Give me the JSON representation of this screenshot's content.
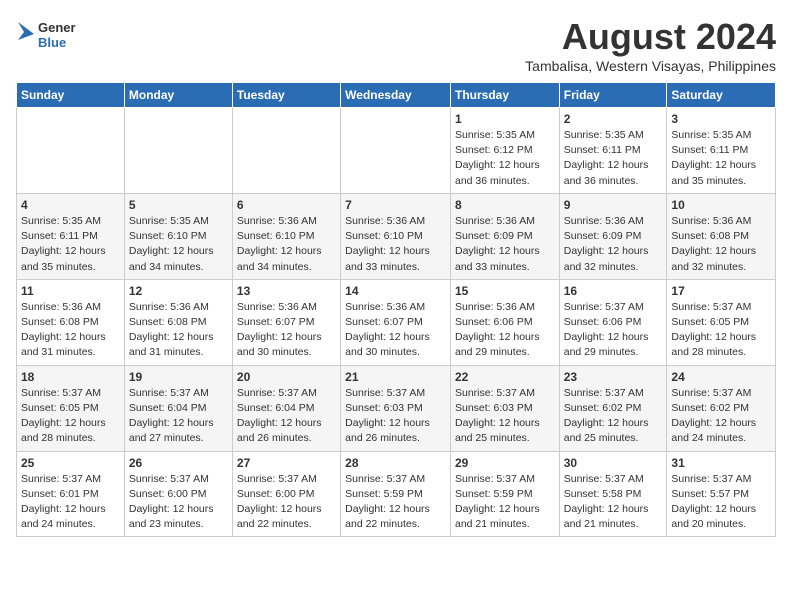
{
  "header": {
    "logo_general": "General",
    "logo_blue": "Blue",
    "title": "August 2024",
    "subtitle": "Tambalisa, Western Visayas, Philippines"
  },
  "calendar": {
    "days_of_week": [
      "Sunday",
      "Monday",
      "Tuesday",
      "Wednesday",
      "Thursday",
      "Friday",
      "Saturday"
    ],
    "weeks": [
      [
        {
          "num": "",
          "info": ""
        },
        {
          "num": "",
          "info": ""
        },
        {
          "num": "",
          "info": ""
        },
        {
          "num": "",
          "info": ""
        },
        {
          "num": "1",
          "info": "Sunrise: 5:35 AM\nSunset: 6:12 PM\nDaylight: 12 hours\nand 36 minutes."
        },
        {
          "num": "2",
          "info": "Sunrise: 5:35 AM\nSunset: 6:11 PM\nDaylight: 12 hours\nand 36 minutes."
        },
        {
          "num": "3",
          "info": "Sunrise: 5:35 AM\nSunset: 6:11 PM\nDaylight: 12 hours\nand 35 minutes."
        }
      ],
      [
        {
          "num": "4",
          "info": "Sunrise: 5:35 AM\nSunset: 6:11 PM\nDaylight: 12 hours\nand 35 minutes."
        },
        {
          "num": "5",
          "info": "Sunrise: 5:35 AM\nSunset: 6:10 PM\nDaylight: 12 hours\nand 34 minutes."
        },
        {
          "num": "6",
          "info": "Sunrise: 5:36 AM\nSunset: 6:10 PM\nDaylight: 12 hours\nand 34 minutes."
        },
        {
          "num": "7",
          "info": "Sunrise: 5:36 AM\nSunset: 6:10 PM\nDaylight: 12 hours\nand 33 minutes."
        },
        {
          "num": "8",
          "info": "Sunrise: 5:36 AM\nSunset: 6:09 PM\nDaylight: 12 hours\nand 33 minutes."
        },
        {
          "num": "9",
          "info": "Sunrise: 5:36 AM\nSunset: 6:09 PM\nDaylight: 12 hours\nand 32 minutes."
        },
        {
          "num": "10",
          "info": "Sunrise: 5:36 AM\nSunset: 6:08 PM\nDaylight: 12 hours\nand 32 minutes."
        }
      ],
      [
        {
          "num": "11",
          "info": "Sunrise: 5:36 AM\nSunset: 6:08 PM\nDaylight: 12 hours\nand 31 minutes."
        },
        {
          "num": "12",
          "info": "Sunrise: 5:36 AM\nSunset: 6:08 PM\nDaylight: 12 hours\nand 31 minutes."
        },
        {
          "num": "13",
          "info": "Sunrise: 5:36 AM\nSunset: 6:07 PM\nDaylight: 12 hours\nand 30 minutes."
        },
        {
          "num": "14",
          "info": "Sunrise: 5:36 AM\nSunset: 6:07 PM\nDaylight: 12 hours\nand 30 minutes."
        },
        {
          "num": "15",
          "info": "Sunrise: 5:36 AM\nSunset: 6:06 PM\nDaylight: 12 hours\nand 29 minutes."
        },
        {
          "num": "16",
          "info": "Sunrise: 5:37 AM\nSunset: 6:06 PM\nDaylight: 12 hours\nand 29 minutes."
        },
        {
          "num": "17",
          "info": "Sunrise: 5:37 AM\nSunset: 6:05 PM\nDaylight: 12 hours\nand 28 minutes."
        }
      ],
      [
        {
          "num": "18",
          "info": "Sunrise: 5:37 AM\nSunset: 6:05 PM\nDaylight: 12 hours\nand 28 minutes."
        },
        {
          "num": "19",
          "info": "Sunrise: 5:37 AM\nSunset: 6:04 PM\nDaylight: 12 hours\nand 27 minutes."
        },
        {
          "num": "20",
          "info": "Sunrise: 5:37 AM\nSunset: 6:04 PM\nDaylight: 12 hours\nand 26 minutes."
        },
        {
          "num": "21",
          "info": "Sunrise: 5:37 AM\nSunset: 6:03 PM\nDaylight: 12 hours\nand 26 minutes."
        },
        {
          "num": "22",
          "info": "Sunrise: 5:37 AM\nSunset: 6:03 PM\nDaylight: 12 hours\nand 25 minutes."
        },
        {
          "num": "23",
          "info": "Sunrise: 5:37 AM\nSunset: 6:02 PM\nDaylight: 12 hours\nand 25 minutes."
        },
        {
          "num": "24",
          "info": "Sunrise: 5:37 AM\nSunset: 6:02 PM\nDaylight: 12 hours\nand 24 minutes."
        }
      ],
      [
        {
          "num": "25",
          "info": "Sunrise: 5:37 AM\nSunset: 6:01 PM\nDaylight: 12 hours\nand 24 minutes."
        },
        {
          "num": "26",
          "info": "Sunrise: 5:37 AM\nSunset: 6:00 PM\nDaylight: 12 hours\nand 23 minutes."
        },
        {
          "num": "27",
          "info": "Sunrise: 5:37 AM\nSunset: 6:00 PM\nDaylight: 12 hours\nand 22 minutes."
        },
        {
          "num": "28",
          "info": "Sunrise: 5:37 AM\nSunset: 5:59 PM\nDaylight: 12 hours\nand 22 minutes."
        },
        {
          "num": "29",
          "info": "Sunrise: 5:37 AM\nSunset: 5:59 PM\nDaylight: 12 hours\nand 21 minutes."
        },
        {
          "num": "30",
          "info": "Sunrise: 5:37 AM\nSunset: 5:58 PM\nDaylight: 12 hours\nand 21 minutes."
        },
        {
          "num": "31",
          "info": "Sunrise: 5:37 AM\nSunset: 5:57 PM\nDaylight: 12 hours\nand 20 minutes."
        }
      ]
    ]
  }
}
